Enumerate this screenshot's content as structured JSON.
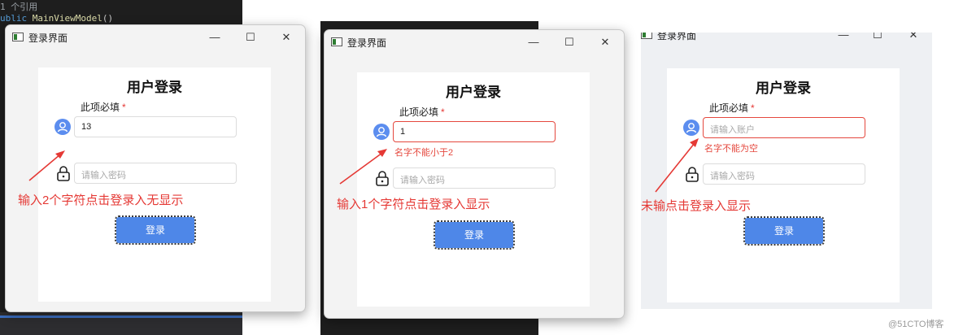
{
  "ide": {
    "ref_count": "1 个引用",
    "code_kw": "ublic",
    "code_fn": "MainViewModel",
    "code_paren": "()"
  },
  "window": {
    "title": "登录界面",
    "minimize": "—",
    "maximize": "☐",
    "close": "✕"
  },
  "form": {
    "heading": "用户登录",
    "required_label": "此项必填",
    "required_star": "*",
    "username_placeholder": "请输入账户",
    "password_placeholder": "请输入密码",
    "login_button": "登录"
  },
  "panels": [
    {
      "username_value": "13",
      "error": "",
      "annotation": "输入2个字符点击登录入无显示"
    },
    {
      "username_value": "1",
      "error": "名字不能小于2",
      "annotation": "输入1个字符点击登录入显示"
    },
    {
      "username_value": "",
      "error": "名字不能为空",
      "annotation": "未输点击登录入显示"
    }
  ],
  "colors": {
    "accent": "#4e87e8",
    "error": "#e5483e",
    "annotation": "#e53935"
  },
  "watermark": "@51CTO博客"
}
